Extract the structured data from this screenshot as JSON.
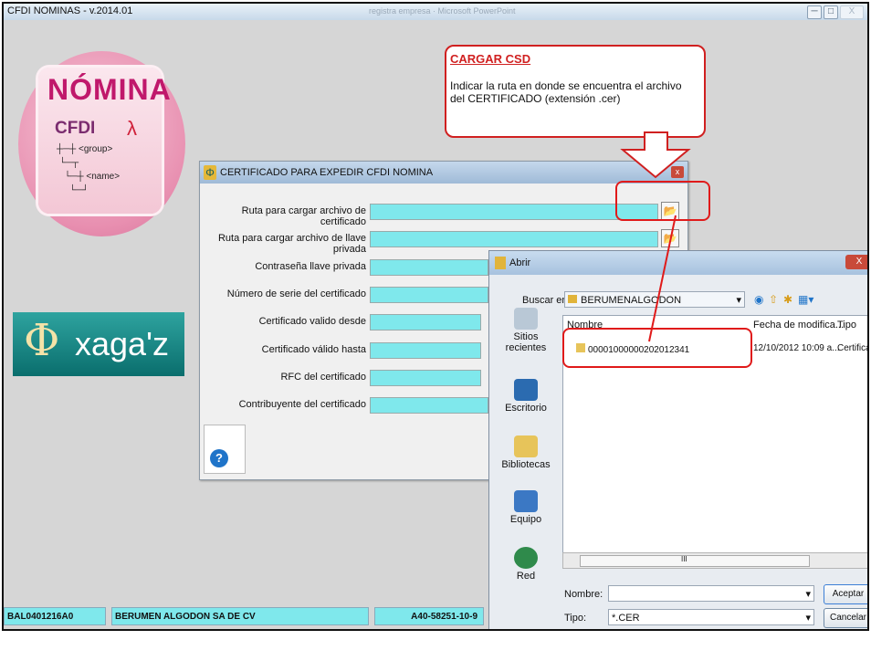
{
  "window": {
    "title": "CFDI NOMINAS - v.2014.01",
    "faded_title": "registra empresa · Microsoft PowerPoint",
    "btn_min": "─",
    "btn_max": "□",
    "btn_close": "X"
  },
  "logo": {
    "nomina": "NÓMINA",
    "cfdi": "CFDI",
    "pdf_glyph": "λ",
    "tree_group": "<group>",
    "tree_name": "<name>",
    "brand_symbol": "Φ",
    "brand_text": "xaga'z"
  },
  "callout": {
    "heading": "CARGAR CSD",
    "body": "Indicar la ruta en donde se encuentra el archivo del CERTIFICADO (extensión .cer)"
  },
  "dialog": {
    "title": "CERTIFICADO PARA EXPEDIR CFDI NOMINA",
    "close": "x",
    "fields": {
      "cert_path": "Ruta para cargar archivo de certificado",
      "key_path": "Ruta para cargar archivo de llave privada",
      "password": "Contraseña llave privada",
      "serial": "Número de serie del certificado",
      "valid_from": "Certificado valido desde",
      "valid_to": "Certificado válido hasta",
      "rfc": "RFC del certificado",
      "taxpayer": "Contribuyente del certificado"
    },
    "help_glyph": "?",
    "browse_glyph": "📂"
  },
  "open_dialog": {
    "title": "Abrir",
    "close": "X",
    "look_in_label": "Buscar en:",
    "look_in_value": "BERUMENALGODON",
    "places": [
      "Sitios recientes",
      "Escritorio",
      "Bibliotecas",
      "Equipo",
      "Red"
    ],
    "columns": [
      "Nombre",
      "Fecha de modifica...",
      "Tipo"
    ],
    "file_name": "00001000000202012341",
    "file_date": "12/10/2012 10:09 a...",
    "file_type": "Certificad",
    "scroll_mark": "III",
    "name_label": "Nombre:",
    "name_value": "",
    "type_label": "Tipo:",
    "type_value": "*.CER",
    "accept": "Aceptar",
    "cancel": "Cancelar"
  },
  "status_bar": {
    "rfc": "BAL0401216A0",
    "company": "BERUMEN ALGODON SA DE CV",
    "code": "A40-58251-10-9"
  },
  "colors": {
    "field_cyan": "#7fe8ec",
    "highlight_red": "#e01a1a",
    "nomina_pink": "#c0186b"
  }
}
